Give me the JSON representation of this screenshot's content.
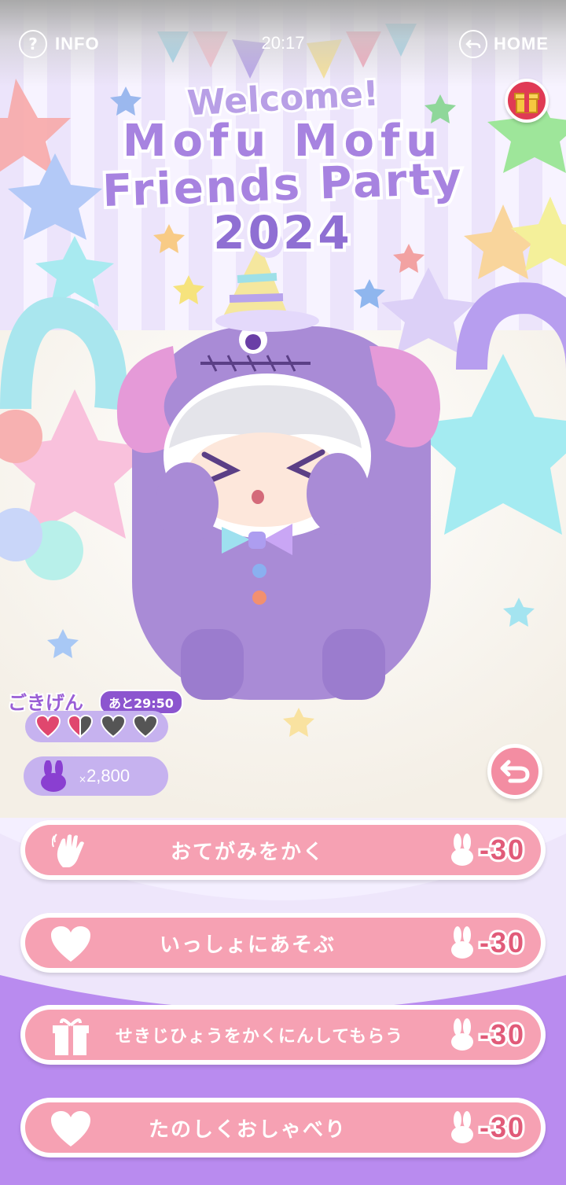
{
  "header": {
    "info_label": "INFO",
    "info_icon": "question-icon",
    "clock": "20:17",
    "home_label": "HOME",
    "home_icon": "back-arrow-icon"
  },
  "title": {
    "line1": "Welcome!",
    "line2": "Mofu Mofu",
    "line3": "Friends Party",
    "line4": "2024"
  },
  "gift": {
    "icon": "gift-icon"
  },
  "status": {
    "mood_label": "ごきげん",
    "timer": "あと29:50",
    "hearts": {
      "filled": 1.5,
      "total": 4
    },
    "currency_icon": "bunny-icon",
    "currency_prefix": "×",
    "currency_value": "2,800"
  },
  "actions": [
    {
      "label": "おてがみをかく",
      "icon": "waving-hand-icon",
      "cost": "-30"
    },
    {
      "label": "いっしょにあそぶ",
      "icon": "heart-icon",
      "cost": "-30"
    },
    {
      "label": "せきじひょうをかくにんしてもらう",
      "icon": "present-icon",
      "cost": "-30"
    },
    {
      "label": "たのしくおしゃべり",
      "icon": "heart-icon",
      "cost": "-30"
    }
  ],
  "colors": {
    "accent_purple": "#a783e0",
    "button_pink": "#f6a1b3",
    "cost_pink": "#e15b79",
    "bottom_panel": "#b98bef"
  }
}
